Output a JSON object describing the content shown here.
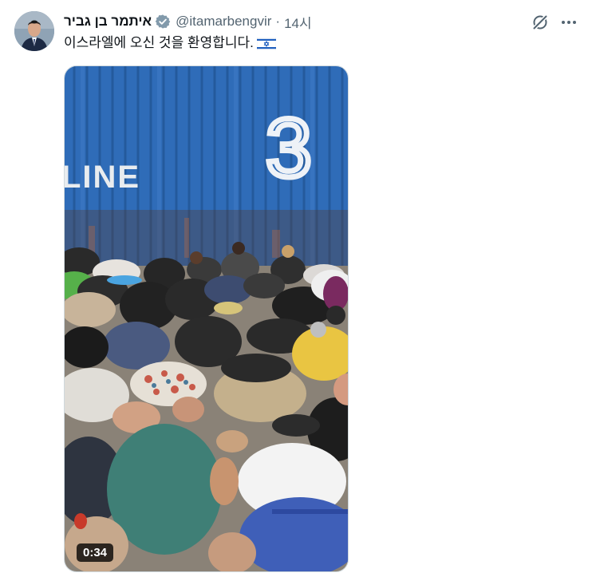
{
  "tweet": {
    "display_name": "איתמר בן גביר",
    "handle": "@itamarbengvir",
    "separator": "·",
    "time": "14시",
    "text": "이스라엘에 오신 것을 환영합니다.",
    "flag_icon": "israel-flag-icon"
  },
  "media": {
    "type": "video",
    "duration": "0:34",
    "container_text_number": "3",
    "container_text_line": "LINE"
  },
  "icons": {
    "verified": "verified-badge-icon",
    "grok": "grok-icon",
    "more": "more-icon"
  },
  "colors": {
    "verified_badge": "#829aab",
    "container_blue": "#2f6cb8",
    "secondary_text": "#536471"
  }
}
